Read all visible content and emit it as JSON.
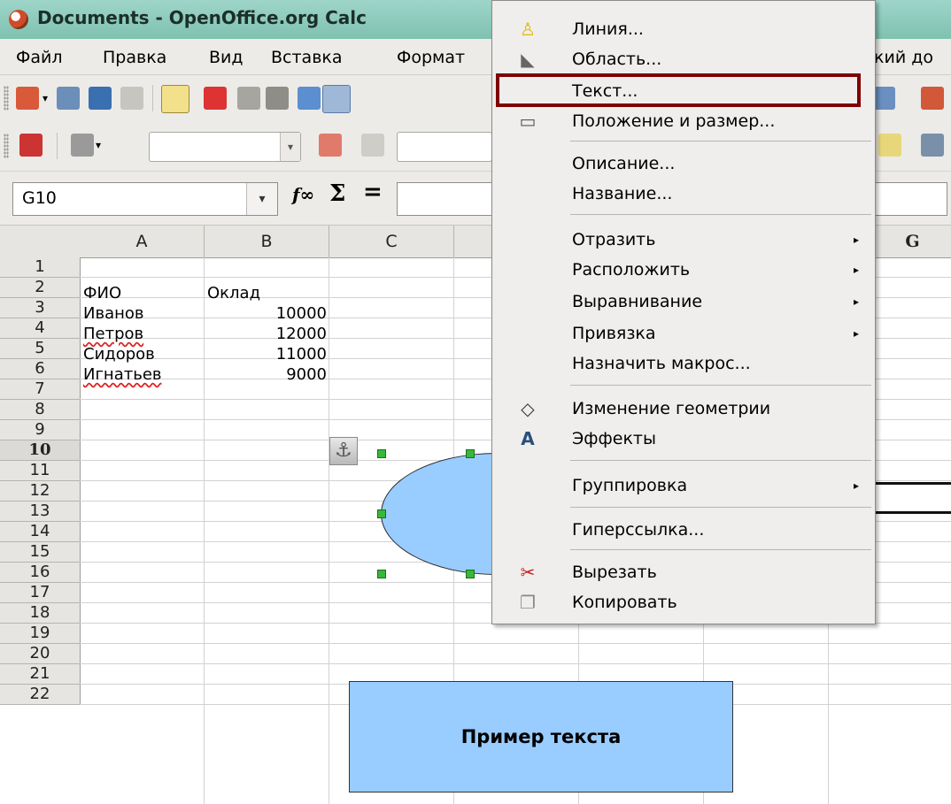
{
  "window": {
    "title": "Documents - OpenOffice.org Calc"
  },
  "menubar": {
    "items": [
      {
        "label": "Файл"
      },
      {
        "label": "Правка"
      },
      {
        "label": "Вид"
      },
      {
        "label": "Вставка"
      },
      {
        "label": "Формат"
      }
    ],
    "tail_label": "кий до"
  },
  "formulabar": {
    "cell_ref": "G10",
    "fx": "f∞",
    "sum": "Σ",
    "equals": "="
  },
  "grid": {
    "columns": [
      "A",
      "B",
      "C",
      "G"
    ],
    "rows": [
      "1",
      "2",
      "3",
      "4",
      "5",
      "6",
      "7",
      "8",
      "9",
      "10",
      "11",
      "12",
      "13",
      "14",
      "15",
      "16",
      "17",
      "18",
      "19",
      "20",
      "21",
      "22"
    ],
    "selected_row": "10",
    "cells": {
      "a2": "ФИО",
      "b2": "Оклад",
      "a3": "Иванов",
      "b3": "10000",
      "a4": "Петров",
      "b4": "12000",
      "a5": "Сидоров",
      "b5": "11000",
      "a6": "Игнатьев",
      "b6": "9000"
    }
  },
  "drawing": {
    "anchor_glyph": "⚓",
    "textbox_text": "Пример текста"
  },
  "context_menu": {
    "items": {
      "line": "Линия...",
      "area": "Область...",
      "text": "Текст...",
      "position": "Положение и размер...",
      "description": "Описание...",
      "name": "Название...",
      "flip": "Отразить",
      "arrange": "Расположить",
      "align": "Выравнивание",
      "anchor": "Привязка",
      "macro": "Назначить макрос...",
      "edit_points": "Изменение геометрии",
      "effects": "Эффекты",
      "group": "Группировка",
      "hyperlink": "Гиперссылка...",
      "cut": "Вырезать",
      "copy": "Копировать"
    },
    "submenu_arrow": "▸",
    "highlighted_item": "Текст...",
    "highlight_color": "#7f0000"
  }
}
